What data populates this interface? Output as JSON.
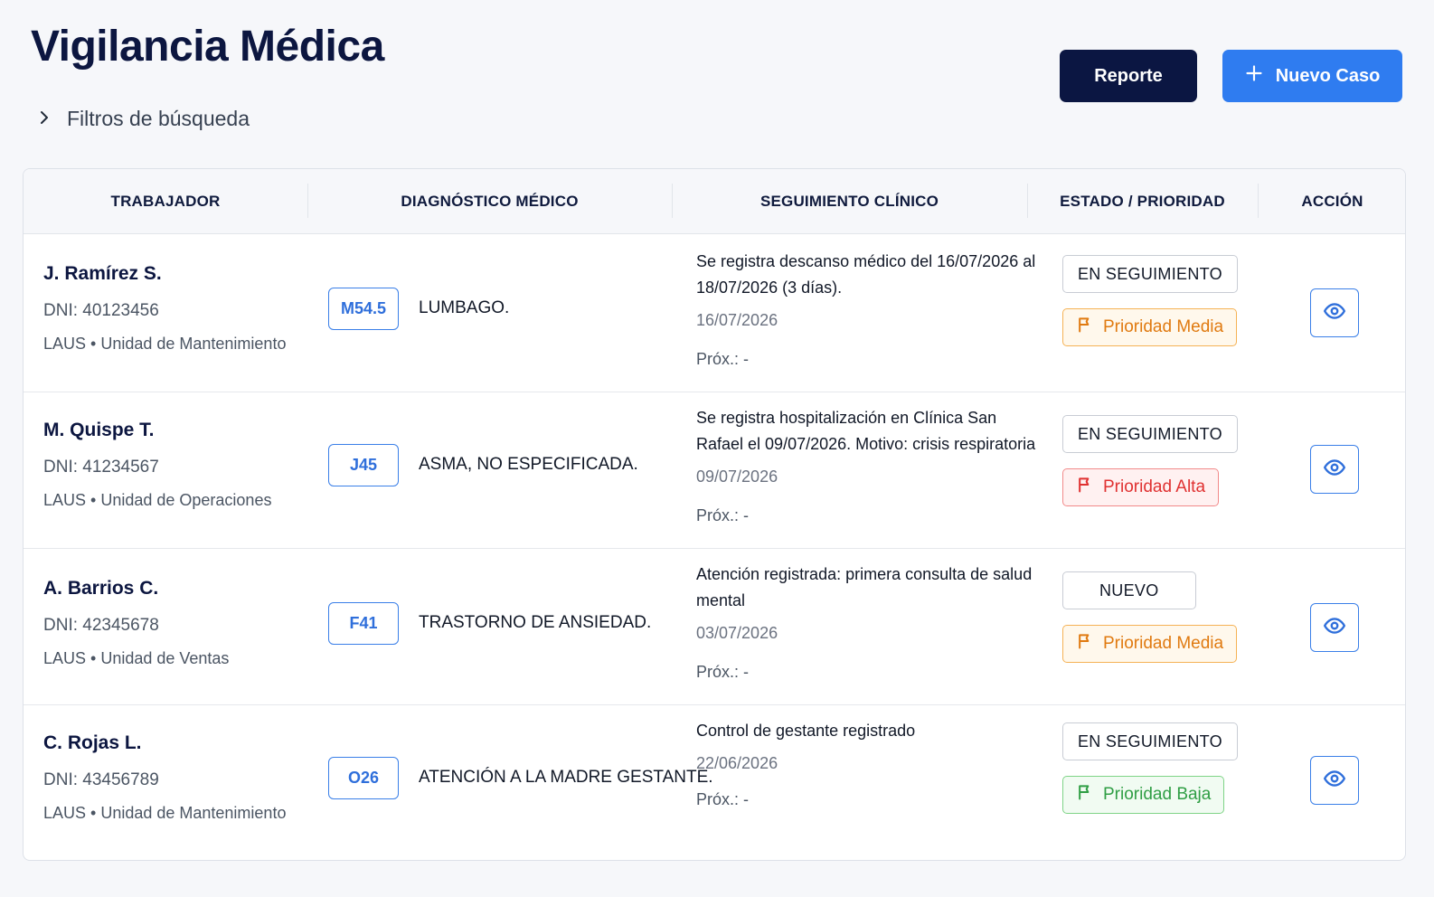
{
  "page": {
    "title": "Vigilancia Médica",
    "filters_label": "Filtros de búsqueda"
  },
  "toolbar": {
    "report_label": "Reporte",
    "new_case_label": "Nuevo Caso"
  },
  "table": {
    "columns": [
      "TRABAJADOR",
      "DIAGNÓSTICO MÉDICO",
      "SEGUIMIENTO CLÍNICO",
      "ESTADO / PRIORIDAD",
      "ACCIÓN"
    ],
    "rows": [
      {
        "name": "J. Ramírez S.",
        "dni": "DNI: 40123456",
        "unit": "LAUS • Unidad de Mantenimiento",
        "code": "M54.5",
        "diagnosis": "LUMBAGO.",
        "followup_text": "Se registra descanso médico del 16/07/2026 al 18/07/2026 (3 días).",
        "followup_date": "16/07/2026",
        "followup_next": "Próx.: -",
        "status": "EN SEGUIMIENTO",
        "priority": "Prioridad Media",
        "priority_level": "media"
      },
      {
        "name": "M. Quispe T.",
        "dni": "DNI: 41234567",
        "unit": "LAUS • Unidad de Operaciones",
        "code": "J45",
        "diagnosis": "ASMA, NO ESPECIFICADA.",
        "followup_text": "Se registra hospitalización en Clínica San Rafael el 09/07/2026. Motivo: crisis respiratoria",
        "followup_date": "09/07/2026",
        "followup_next": "Próx.: -",
        "status": "EN SEGUIMIENTO",
        "priority": "Prioridad Alta",
        "priority_level": "alta"
      },
      {
        "name": "A. Barrios C.",
        "dni": "DNI: 42345678",
        "unit": "LAUS • Unidad de Ventas",
        "code": "F41",
        "diagnosis": "TRASTORNO DE ANSIEDAD.",
        "followup_text": "Atención registrada: primera consulta de salud mental",
        "followup_date": "03/07/2026",
        "followup_next": "Próx.: -",
        "status": "NUEVO",
        "priority": "Prioridad Media",
        "priority_level": "media"
      },
      {
        "name": "C. Rojas L.",
        "dni": "DNI: 43456789",
        "unit": "LAUS • Unidad de Mantenimiento",
        "code": "O26",
        "diagnosis": "ATENCIÓN A LA MADRE GESTANTE.",
        "followup_text": "Control de gestante registrado",
        "followup_date": "22/06/2026",
        "followup_next": "Próx.: -",
        "status": "EN SEGUIMIENTO",
        "priority": "Prioridad Baja",
        "priority_level": "baja"
      }
    ]
  },
  "icons": {
    "filters": "chevron-right-icon",
    "new_case": "plus-icon",
    "priority": "flag-icon",
    "action": "eye-icon"
  },
  "colors": {
    "title": "#0c1640",
    "report_button": "#0b1642",
    "new_case_button": "#2f7cf0",
    "priority_media": "#e07a10",
    "priority_alta": "#e03131",
    "priority_baja": "#2f9e44"
  }
}
